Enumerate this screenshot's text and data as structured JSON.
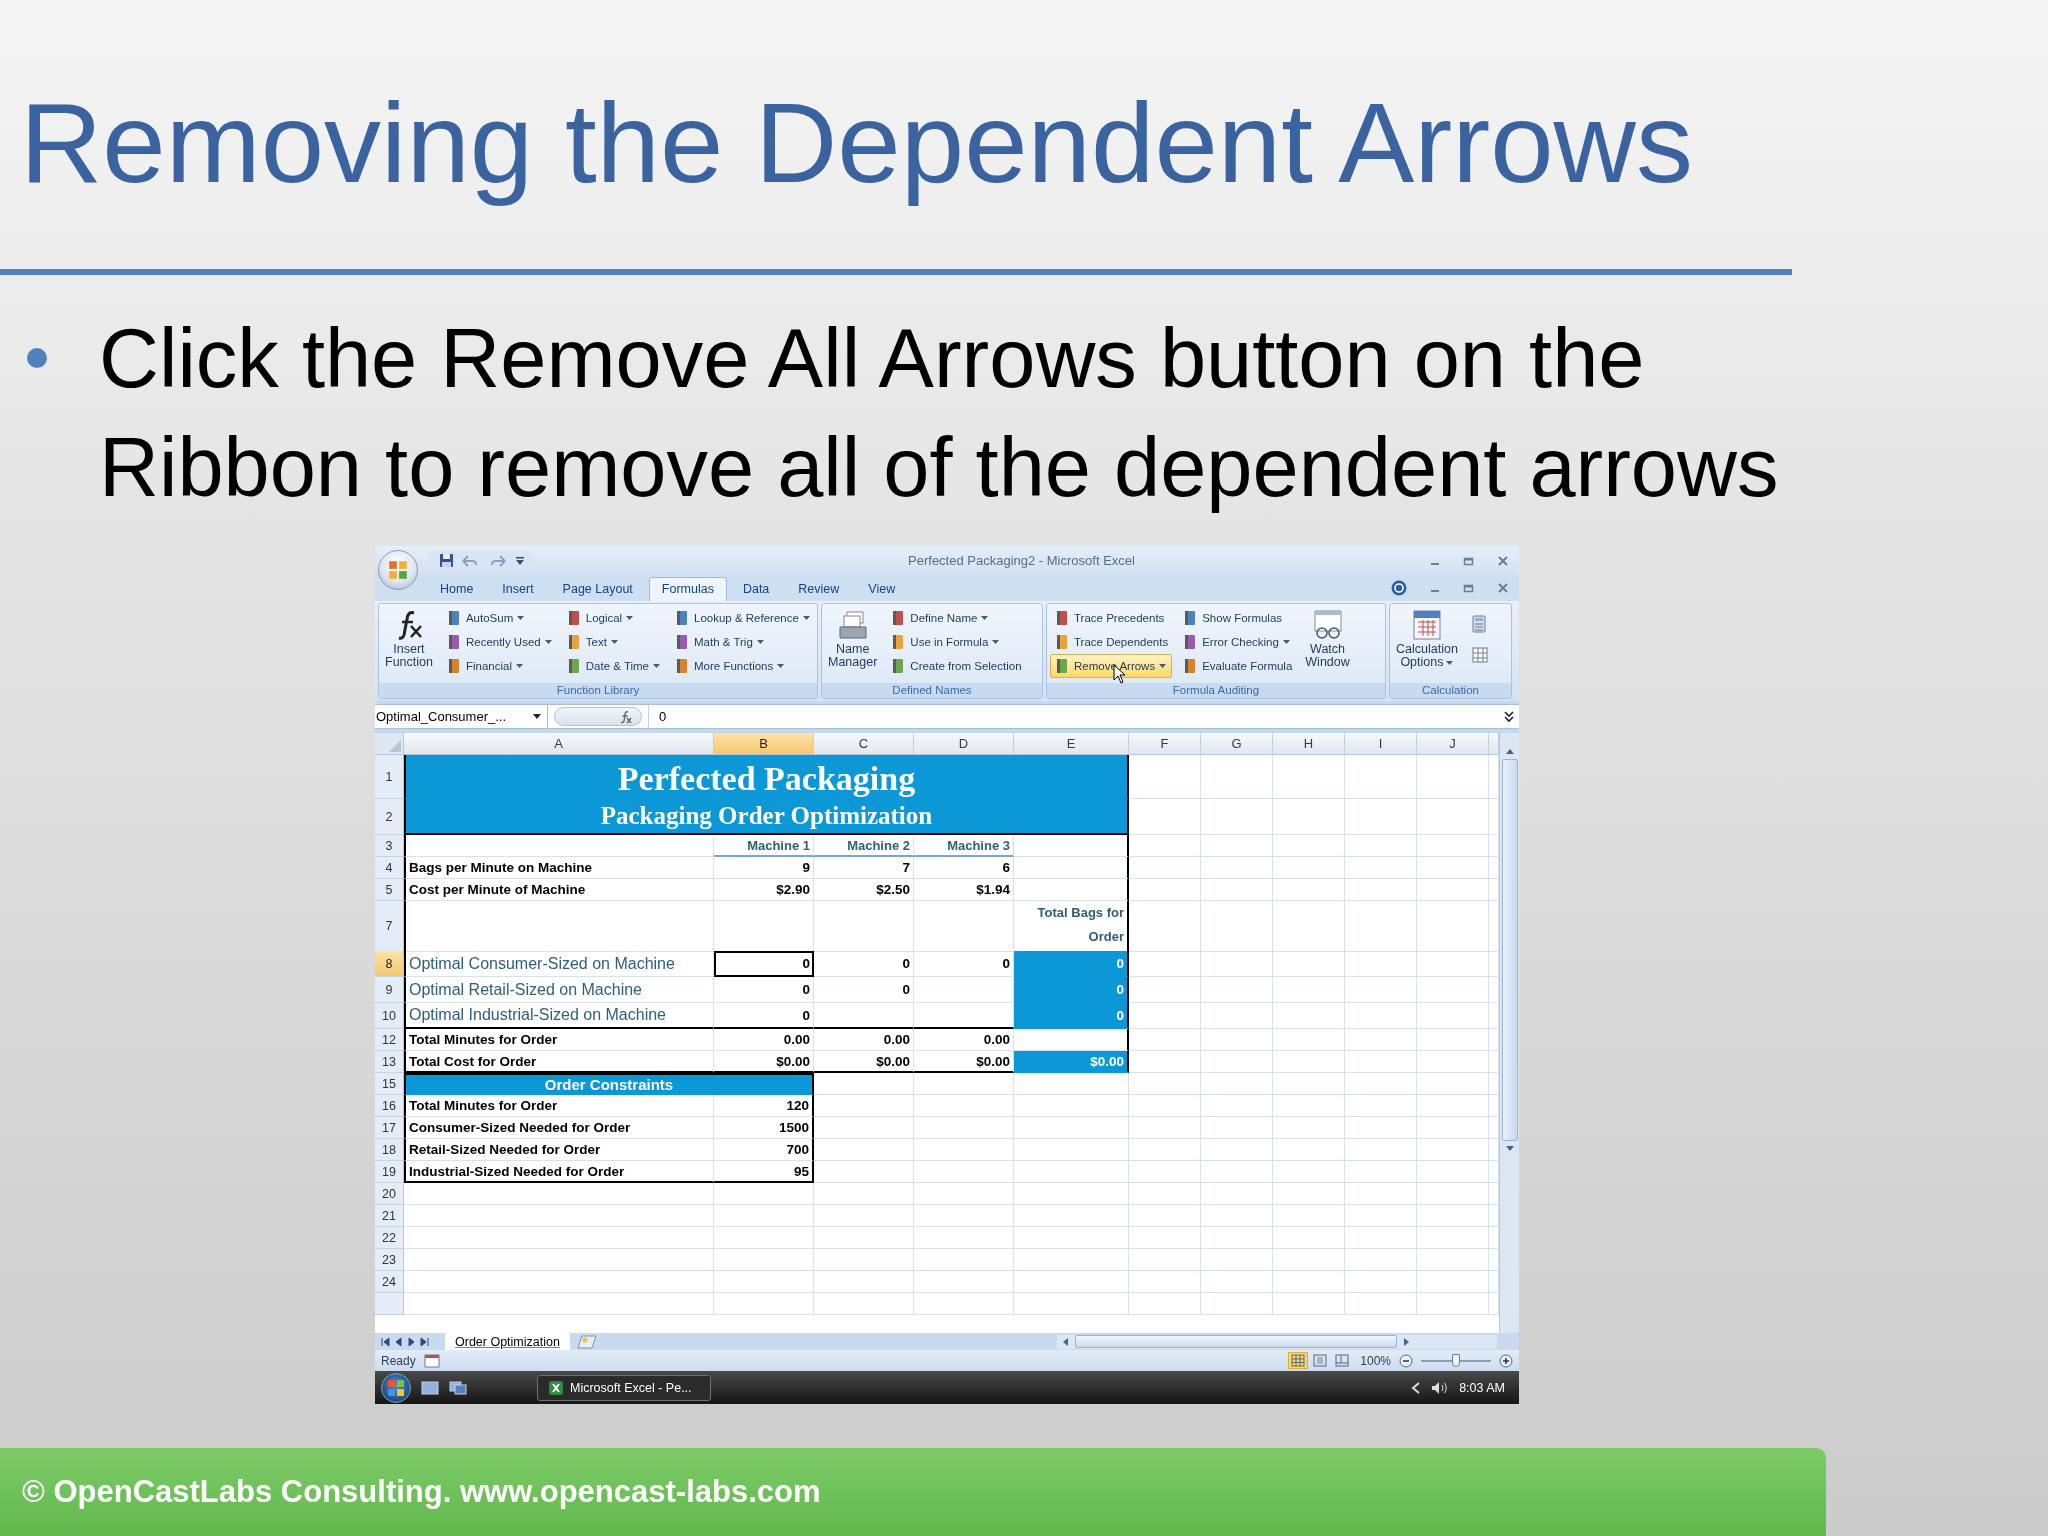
{
  "slide": {
    "title": "Removing the Dependent Arrows",
    "bullets": [
      "Click the Remove All Arrows button on the Ribbon to remove all of the dependent arrows"
    ],
    "footer": "© OpenCastLabs Consulting. www.opencast-labs.com"
  },
  "excel": {
    "title": "Perfected Packaging2 - Microsoft Excel",
    "tabs": [
      {
        "label": "Home",
        "selected": false
      },
      {
        "label": "Insert",
        "selected": false
      },
      {
        "label": "Page Layout",
        "selected": false
      },
      {
        "label": "Formulas",
        "selected": true
      },
      {
        "label": "Data",
        "selected": false
      },
      {
        "label": "Review",
        "selected": false
      },
      {
        "label": "View",
        "selected": false
      }
    ],
    "ribbon": [
      {
        "label": "Function Library",
        "columns": [
          [
            {
              "kind": "large",
              "label": "Insert Function",
              "dropdown": false,
              "highlighted": false
            }
          ],
          [
            {
              "kind": "small",
              "label": "AutoSum",
              "dropdown": true,
              "highlighted": false
            },
            {
              "kind": "small",
              "label": "Recently Used",
              "dropdown": true,
              "highlighted": false
            },
            {
              "kind": "small",
              "label": "Financial",
              "dropdown": true,
              "highlighted": false
            }
          ],
          [
            {
              "kind": "small",
              "label": "Logical",
              "dropdown": true,
              "highlighted": false
            },
            {
              "kind": "small",
              "label": "Text",
              "dropdown": true,
              "highlighted": false
            },
            {
              "kind": "small",
              "label": "Date & Time",
              "dropdown": true,
              "highlighted": false
            }
          ],
          [
            {
              "kind": "small",
              "label": "Lookup & Reference",
              "dropdown": true,
              "highlighted": false
            },
            {
              "kind": "small",
              "label": "Math & Trig",
              "dropdown": true,
              "highlighted": false
            },
            {
              "kind": "small",
              "label": "More Functions",
              "dropdown": true,
              "highlighted": false
            }
          ]
        ]
      },
      {
        "label": "Defined Names",
        "columns": [
          [
            {
              "kind": "large",
              "label": "Name Manager",
              "dropdown": false,
              "highlighted": false
            }
          ],
          [
            {
              "kind": "small",
              "label": "Define Name",
              "dropdown": true,
              "highlighted": false
            },
            {
              "kind": "small",
              "label": "Use in Formula",
              "dropdown": true,
              "highlighted": false
            },
            {
              "kind": "small",
              "label": "Create from Selection",
              "dropdown": false,
              "highlighted": false
            }
          ]
        ]
      },
      {
        "label": "Formula Auditing",
        "columns": [
          [
            {
              "kind": "small",
              "label": "Trace Precedents",
              "dropdown": false,
              "highlighted": false
            },
            {
              "kind": "small",
              "label": "Trace Dependents",
              "dropdown": false,
              "highlighted": false
            },
            {
              "kind": "small",
              "label": "Remove Arrows",
              "dropdown": true,
              "highlighted": true
            }
          ],
          [
            {
              "kind": "small",
              "label": "Show Formulas",
              "dropdown": false,
              "highlighted": false
            },
            {
              "kind": "small",
              "label": "Error Checking",
              "dropdown": true,
              "highlighted": false
            },
            {
              "kind": "small",
              "label": "Evaluate Formula",
              "dropdown": false,
              "highlighted": false
            }
          ],
          [
            {
              "kind": "large",
              "label": "Watch Window",
              "dropdown": false,
              "highlighted": false
            }
          ]
        ]
      },
      {
        "label": "Calculation",
        "columns": [
          [
            {
              "kind": "large",
              "label": "Calculation Options",
              "dropdown": true,
              "highlighted": false
            }
          ],
          [
            {
              "kind": "icon",
              "highlighted": false
            },
            {
              "kind": "icon",
              "highlighted": false
            }
          ]
        ]
      }
    ],
    "name_box": "Optimal_Consumer_...",
    "formula": "0",
    "columns": [
      {
        "label": "A",
        "selected": false
      },
      {
        "label": "B",
        "selected": true
      },
      {
        "label": "C",
        "selected": false
      },
      {
        "label": "D",
        "selected": false
      },
      {
        "label": "E",
        "selected": false
      },
      {
        "label": "F",
        "selected": false
      },
      {
        "label": "G",
        "selected": false
      },
      {
        "label": "H",
        "selected": false
      },
      {
        "label": "I",
        "selected": false
      },
      {
        "label": "J",
        "selected": false
      }
    ],
    "rows": [
      {
        "number": "1",
        "selected": false,
        "kind": "title",
        "text": "Perfected Packaging"
      },
      {
        "number": "2",
        "selected": false,
        "kind": "subtitle",
        "text": "Packaging Order Optimization"
      },
      {
        "number": "3",
        "selected": false,
        "kind": "header",
        "columns": [
          "Machine 1",
          "Machine 2",
          "Machine 3"
        ]
      },
      {
        "number": "4",
        "selected": false,
        "kind": "data",
        "label": "Bags per Minute on Machine",
        "values": [
          "9",
          "7",
          "6"
        ]
      },
      {
        "number": "5",
        "selected": false,
        "kind": "data",
        "label": "Cost per Minute of Machine",
        "values": [
          "$2.90",
          "$2.50",
          "$1.94"
        ]
      },
      {
        "number": "7",
        "selected": false,
        "kind": "total-header",
        "total_heading": "Total Bags for Order"
      },
      {
        "number": "8",
        "selected": true,
        "kind": "decision",
        "label": "Optimal Consumer-Sized on Machine",
        "values": [
          "0",
          "0",
          "0"
        ],
        "total": "0"
      },
      {
        "number": "9",
        "selected": false,
        "kind": "decision",
        "label": "Optimal Retail-Sized on Machine",
        "values": [
          "0",
          "0"
        ],
        "total": "0"
      },
      {
        "number": "10",
        "selected": false,
        "kind": "decision",
        "label": "Optimal Industrial-Sized on Machine",
        "values": [
          "0"
        ],
        "total": "0"
      },
      {
        "number": "12",
        "selected": false,
        "kind": "data",
        "label": "Total Minutes for Order",
        "values": [
          "0.00",
          "0.00",
          "0.00"
        ]
      },
      {
        "number": "13",
        "selected": false,
        "kind": "data",
        "label": "Total Cost for Order",
        "values": [
          "$0.00",
          "$0.00",
          "$0.00"
        ],
        "total": "$0.00"
      },
      {
        "number": "15",
        "selected": false,
        "kind": "section",
        "text": "Order Constraints"
      },
      {
        "number": "16",
        "selected": false,
        "kind": "constraint",
        "label": "Total Minutes for Order",
        "values": [
          "120"
        ]
      },
      {
        "number": "17",
        "selected": false,
        "kind": "constraint",
        "label": "Consumer-Sized Needed for Order",
        "values": [
          "1500"
        ]
      },
      {
        "number": "18",
        "selected": false,
        "kind": "constraint",
        "label": "Retail-Sized Needed for Order",
        "values": [
          "700"
        ]
      },
      {
        "number": "19",
        "selected": false,
        "kind": "constraint",
        "label": "Industrial-Sized Needed for Order",
        "values": [
          "95"
        ]
      },
      {
        "number": "20",
        "selected": false,
        "kind": "blank"
      },
      {
        "number": "21",
        "selected": false,
        "kind": "blank"
      },
      {
        "number": "22",
        "selected": false,
        "kind": "blank"
      },
      {
        "number": "23",
        "selected": false,
        "kind": "blank"
      },
      {
        "number": "24",
        "selected": false,
        "kind": "blank"
      }
    ],
    "sheet_tabs": [
      {
        "label": "Order Optimization",
        "selected": true
      }
    ],
    "status": "Ready",
    "view_buttons": [
      {
        "selected": true
      },
      {
        "selected": false
      },
      {
        "selected": false
      }
    ],
    "zoom": {
      "label": "100%",
      "level": 0.5
    },
    "taskbar": {
      "task": "Microsoft Excel - Pe...",
      "time": "8:03 AM"
    }
  }
}
